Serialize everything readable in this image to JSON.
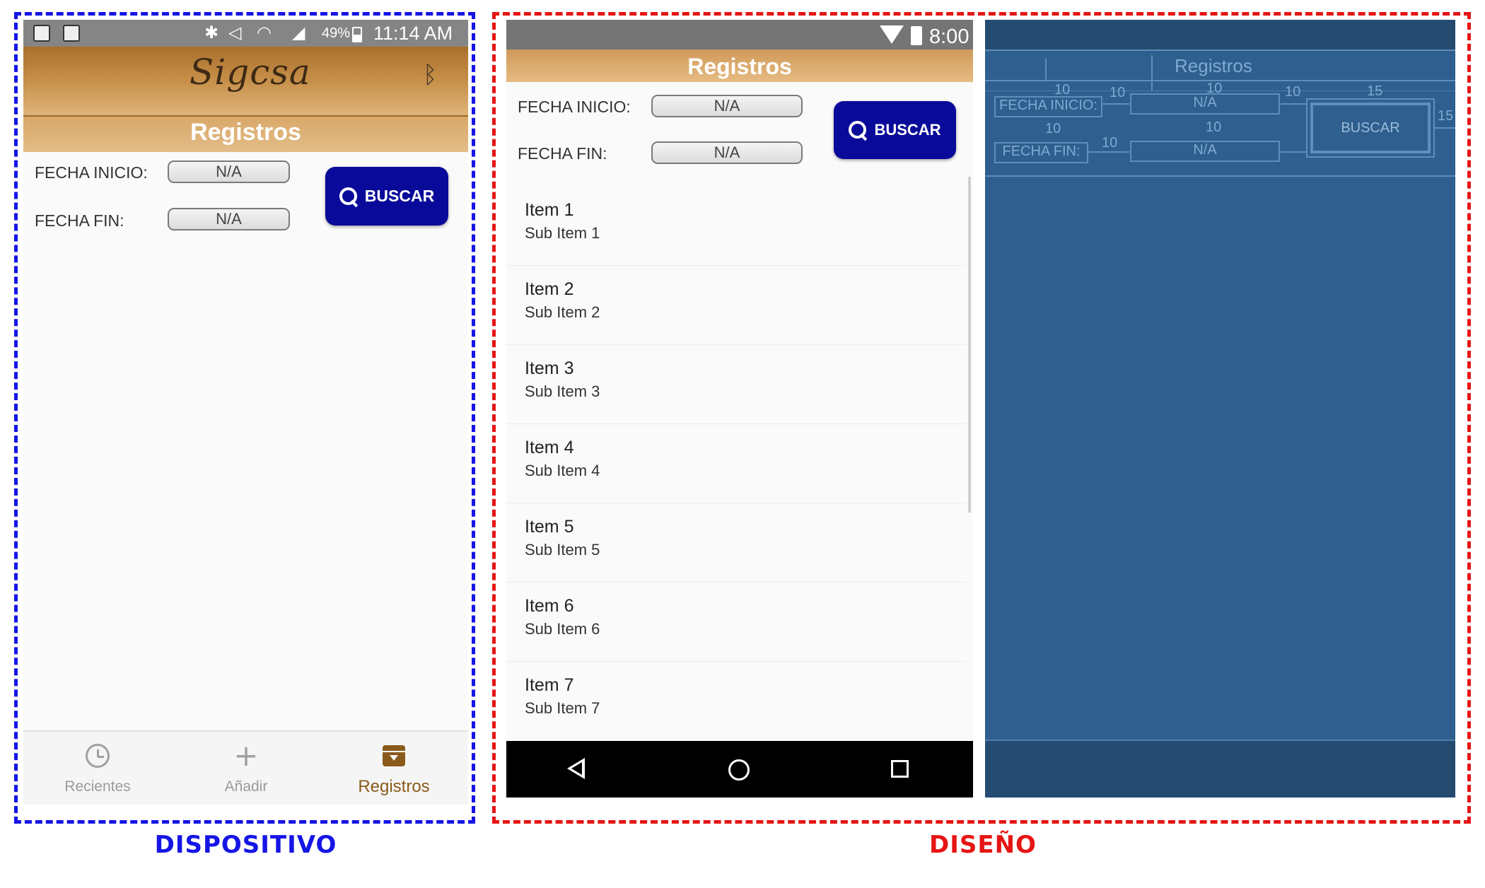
{
  "device": {
    "status": {
      "battery": "49%",
      "time": "11:14 AM"
    },
    "logo": "Sigcsa",
    "title": "Registros",
    "form": {
      "start_label": "FECHA INICIO:",
      "start_value": "N/A",
      "end_label": "FECHA FIN:",
      "end_value": "N/A",
      "search_label": "BUSCAR"
    },
    "nav": [
      {
        "label": "Recientes",
        "icon": "clock-icon"
      },
      {
        "label": "Añadir",
        "icon": "plus-icon"
      },
      {
        "label": "Registros",
        "icon": "archive-icon"
      }
    ],
    "caption": "DISPOSITIVO"
  },
  "design": {
    "status": {
      "time": "8:00"
    },
    "title": "Registros",
    "form": {
      "start_label": "FECHA INICIO:",
      "start_value": "N/A",
      "end_label": "FECHA FIN:",
      "end_value": "N/A",
      "search_label": "BUSCAR"
    },
    "items": [
      {
        "title": "Item 1",
        "subtitle": "Sub Item 1"
      },
      {
        "title": "Item 2",
        "subtitle": "Sub Item 2"
      },
      {
        "title": "Item 3",
        "subtitle": "Sub Item 3"
      },
      {
        "title": "Item 4",
        "subtitle": "Sub Item 4"
      },
      {
        "title": "Item 5",
        "subtitle": "Sub Item 5"
      },
      {
        "title": "Item 6",
        "subtitle": "Sub Item 6"
      },
      {
        "title": "Item 7",
        "subtitle": "Sub Item 7"
      }
    ],
    "caption": "DISEÑO"
  },
  "blueprint": {
    "title": "Registros",
    "start_label": "FECHA INICIO:",
    "start_value": "N/A",
    "end_label": "FECHA FIN:",
    "end_value": "N/A",
    "search_label": "BUSCAR",
    "constraints": [
      "10",
      "10",
      "10",
      "10",
      "10",
      "10",
      "10",
      "15",
      "15"
    ]
  },
  "colors": {
    "device_frame": "#1515e6",
    "design_frame": "#e61515",
    "header_gold": "#c48c45",
    "button_navy": "#0a0a9a",
    "active_nav": "#8a5a1a",
    "blueprint": "#2e5f8e"
  }
}
